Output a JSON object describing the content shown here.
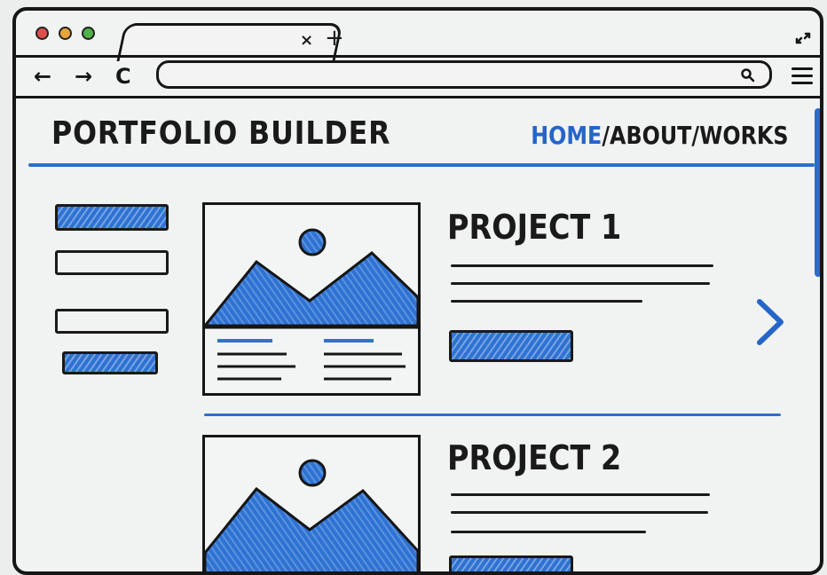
{
  "browser": {
    "window_controls": [
      "close-dot",
      "minimize-dot",
      "maximize-dot"
    ],
    "tab": {
      "close_glyph": "×",
      "new_tab_glyph": "+"
    },
    "nav": {
      "back_glyph": "←",
      "forward_glyph": "→",
      "reload_glyph": "C"
    },
    "address": {
      "value": "",
      "placeholder": ""
    },
    "colors": {
      "close": "#e0504b",
      "minimize": "#e6a53a",
      "maximize": "#4fb24a"
    }
  },
  "site": {
    "title": "PORTFOLIO BUILDER",
    "nav": {
      "home": "HOME",
      "separator": "/",
      "about": "ABOUT",
      "works": "WORKS"
    },
    "accent_color": "#2e6ec8"
  },
  "projects": [
    {
      "title": "PROJECT 1"
    },
    {
      "title": "PROJECT 2"
    }
  ],
  "icons": {
    "next": "chevron-right-icon",
    "search": "search-icon",
    "menu": "hamburger-menu-icon",
    "resize": "expand-icon"
  }
}
